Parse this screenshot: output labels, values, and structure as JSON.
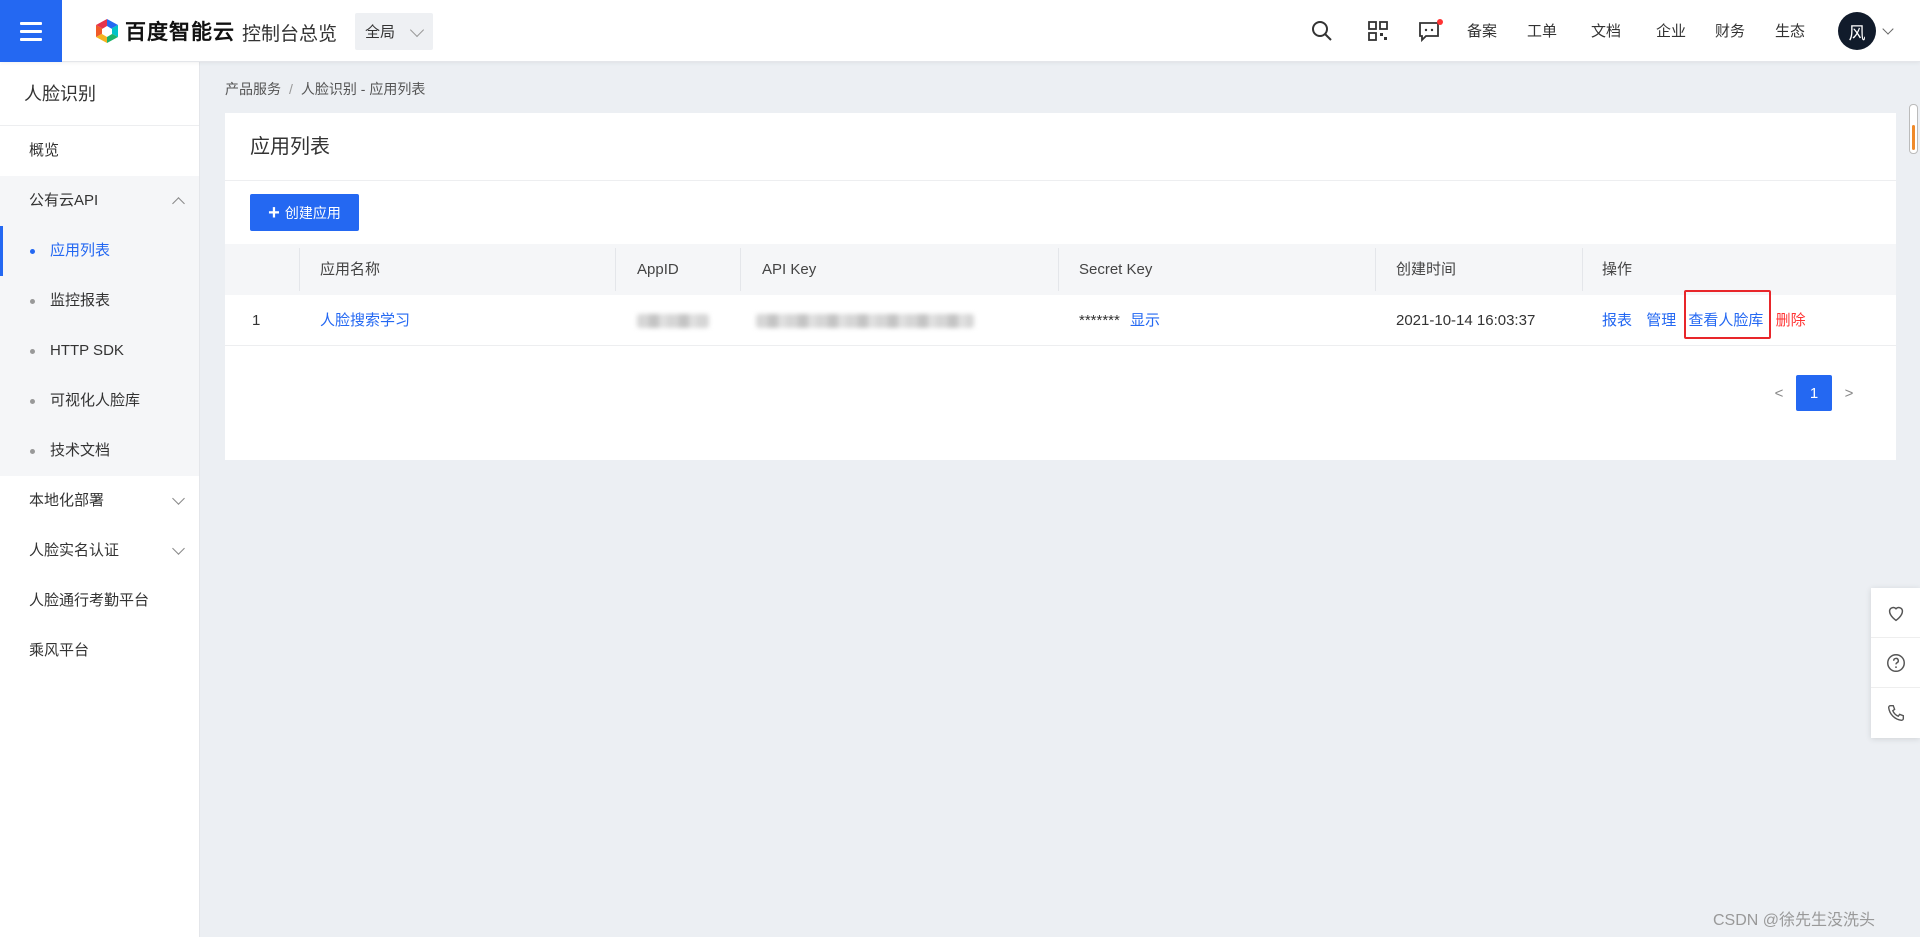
{
  "header": {
    "brand": "百度智能云",
    "console_link": "控制台总览",
    "scope_select": "全局",
    "nav": [
      "备案",
      "工单",
      "文档",
      "企业",
      "财务",
      "生态"
    ],
    "avatar_text": "风",
    "accent": "#2468f2"
  },
  "sidebar": {
    "title": "人脸识别",
    "items": [
      {
        "label": "概览"
      },
      {
        "label": "公有云API",
        "expanded": true,
        "children": [
          "应用列表",
          "监控报表",
          "HTTP SDK",
          "可视化人脸库",
          "技术文档"
        ],
        "active_child": "应用列表"
      },
      {
        "label": "本地化部署",
        "expanded": false
      },
      {
        "label": "人脸实名认证",
        "expanded": false
      },
      {
        "label": "人脸通行考勤平台"
      },
      {
        "label": "乘风平台"
      }
    ]
  },
  "breadcrumb": {
    "root": "产品服务",
    "separator": "/",
    "current": "人脸识别 - 应用列表"
  },
  "panel": {
    "title": "应用列表",
    "create_button": "创建应用",
    "columns": [
      "应用名称",
      "AppID",
      "API Key",
      "Secret Key",
      "创建时间",
      "操作"
    ],
    "rows": [
      {
        "index": "1",
        "name": "人脸搜索学习",
        "app_id_masked": true,
        "api_key_masked": true,
        "secret_key": "*******",
        "secret_show": "显示",
        "created": "2021-10-14 16:03:37",
        "actions": [
          "报表",
          "管理",
          "查看人脸库",
          "删除"
        ]
      }
    ],
    "pagination": {
      "prev": "<",
      "current": "1",
      "next": ">"
    }
  },
  "watermark": "CSDN @徐先生没洗头"
}
